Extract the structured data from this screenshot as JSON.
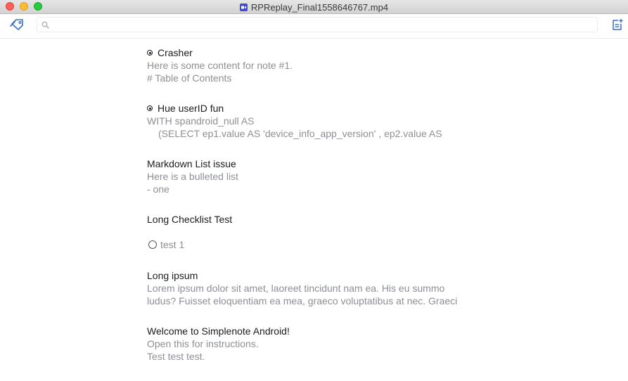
{
  "window": {
    "title": "RPReplay_Final1558646767.mp4"
  },
  "toolbar": {
    "tags_button": "tag-icon",
    "search": {
      "value": "",
      "placeholder": ""
    },
    "new_note_button": "new-note-icon"
  },
  "notes": [
    {
      "title": "Crasher",
      "pinned": true,
      "lines": [
        "Here is some content for note #1.",
        "# Table of Contents"
      ]
    },
    {
      "title": "Hue userID fun",
      "pinned": true,
      "lines": [
        "WITH spandroid_null AS",
        "(SELECT ep1.value AS 'device_info_app_version' , ep2.value AS"
      ]
    },
    {
      "title": "Markdown List issue",
      "pinned": false,
      "lines": [
        "Here is a bulleted list",
        "- one"
      ]
    },
    {
      "title": "Long Checklist Test",
      "pinned": false,
      "lines": [
        "",
        "test 1"
      ]
    },
    {
      "title": "Long ipsum",
      "pinned": false,
      "lines": [
        "Lorem ipsum dolor sit amet, laoreet tincidunt nam ea. His eu summo",
        "ludus? Fuisset eloquentiam ea mea, graeco voluptatibus at nec. Graeci"
      ]
    },
    {
      "title": "Welcome to Simplenote Android!",
      "pinned": false,
      "lines": [
        "Open this for instructions.",
        "Test test test."
      ]
    }
  ],
  "colors": {
    "accent": "#3a6fcf",
    "title_text": "#1b1b1b",
    "preview_text": "#8c8f94"
  }
}
